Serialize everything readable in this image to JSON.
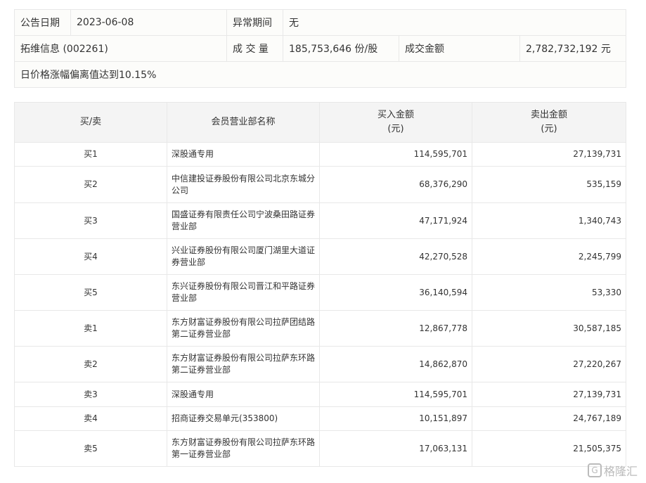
{
  "info": {
    "date_label": "公告日期",
    "date": "2023-06-08",
    "period_label": "异常期间",
    "period": "无",
    "stock": "拓维信息 (002261)",
    "volume_label": "成 交 量",
    "volume": "185,753,646 份/股",
    "amount_label": "成交金额",
    "amount": "2,782,732,192 元",
    "reason": "日价格涨幅偏离值达到10.15%"
  },
  "table": {
    "headers": [
      "买/卖",
      "会员营业部名称",
      "买入金额\n(元)",
      "卖出金额\n(元)"
    ],
    "rows": [
      [
        "买1",
        "深股通专用",
        "114,595,701",
        "27,139,731"
      ],
      [
        "买2",
        "中信建投证券股份有限公司北京东城分公司",
        "68,376,290",
        "535,159"
      ],
      [
        "买3",
        "国盛证券有限责任公司宁波桑田路证券营业部",
        "47,171,924",
        "1,340,743"
      ],
      [
        "买4",
        "兴业证券股份有限公司厦门湖里大道证券营业部",
        "42,270,528",
        "2,245,799"
      ],
      [
        "买5",
        "东兴证券股份有限公司晋江和平路证券营业部",
        "36,140,594",
        "53,330"
      ],
      [
        "卖1",
        "东方财富证券股份有限公司拉萨团结路第二证券营业部",
        "12,867,778",
        "30,587,185"
      ],
      [
        "卖2",
        "东方财富证券股份有限公司拉萨东环路第二证券营业部",
        "14,862,870",
        "27,220,267"
      ],
      [
        "卖3",
        "深股通专用",
        "114,595,701",
        "27,139,731"
      ],
      [
        "卖4",
        "招商证券交易单元(353800)",
        "10,151,897",
        "24,767,189"
      ],
      [
        "卖5",
        "东方财富证券股份有限公司拉萨东环路第一证券营业部",
        "17,063,131",
        "21,505,375"
      ]
    ]
  },
  "watermark": "格隆汇"
}
